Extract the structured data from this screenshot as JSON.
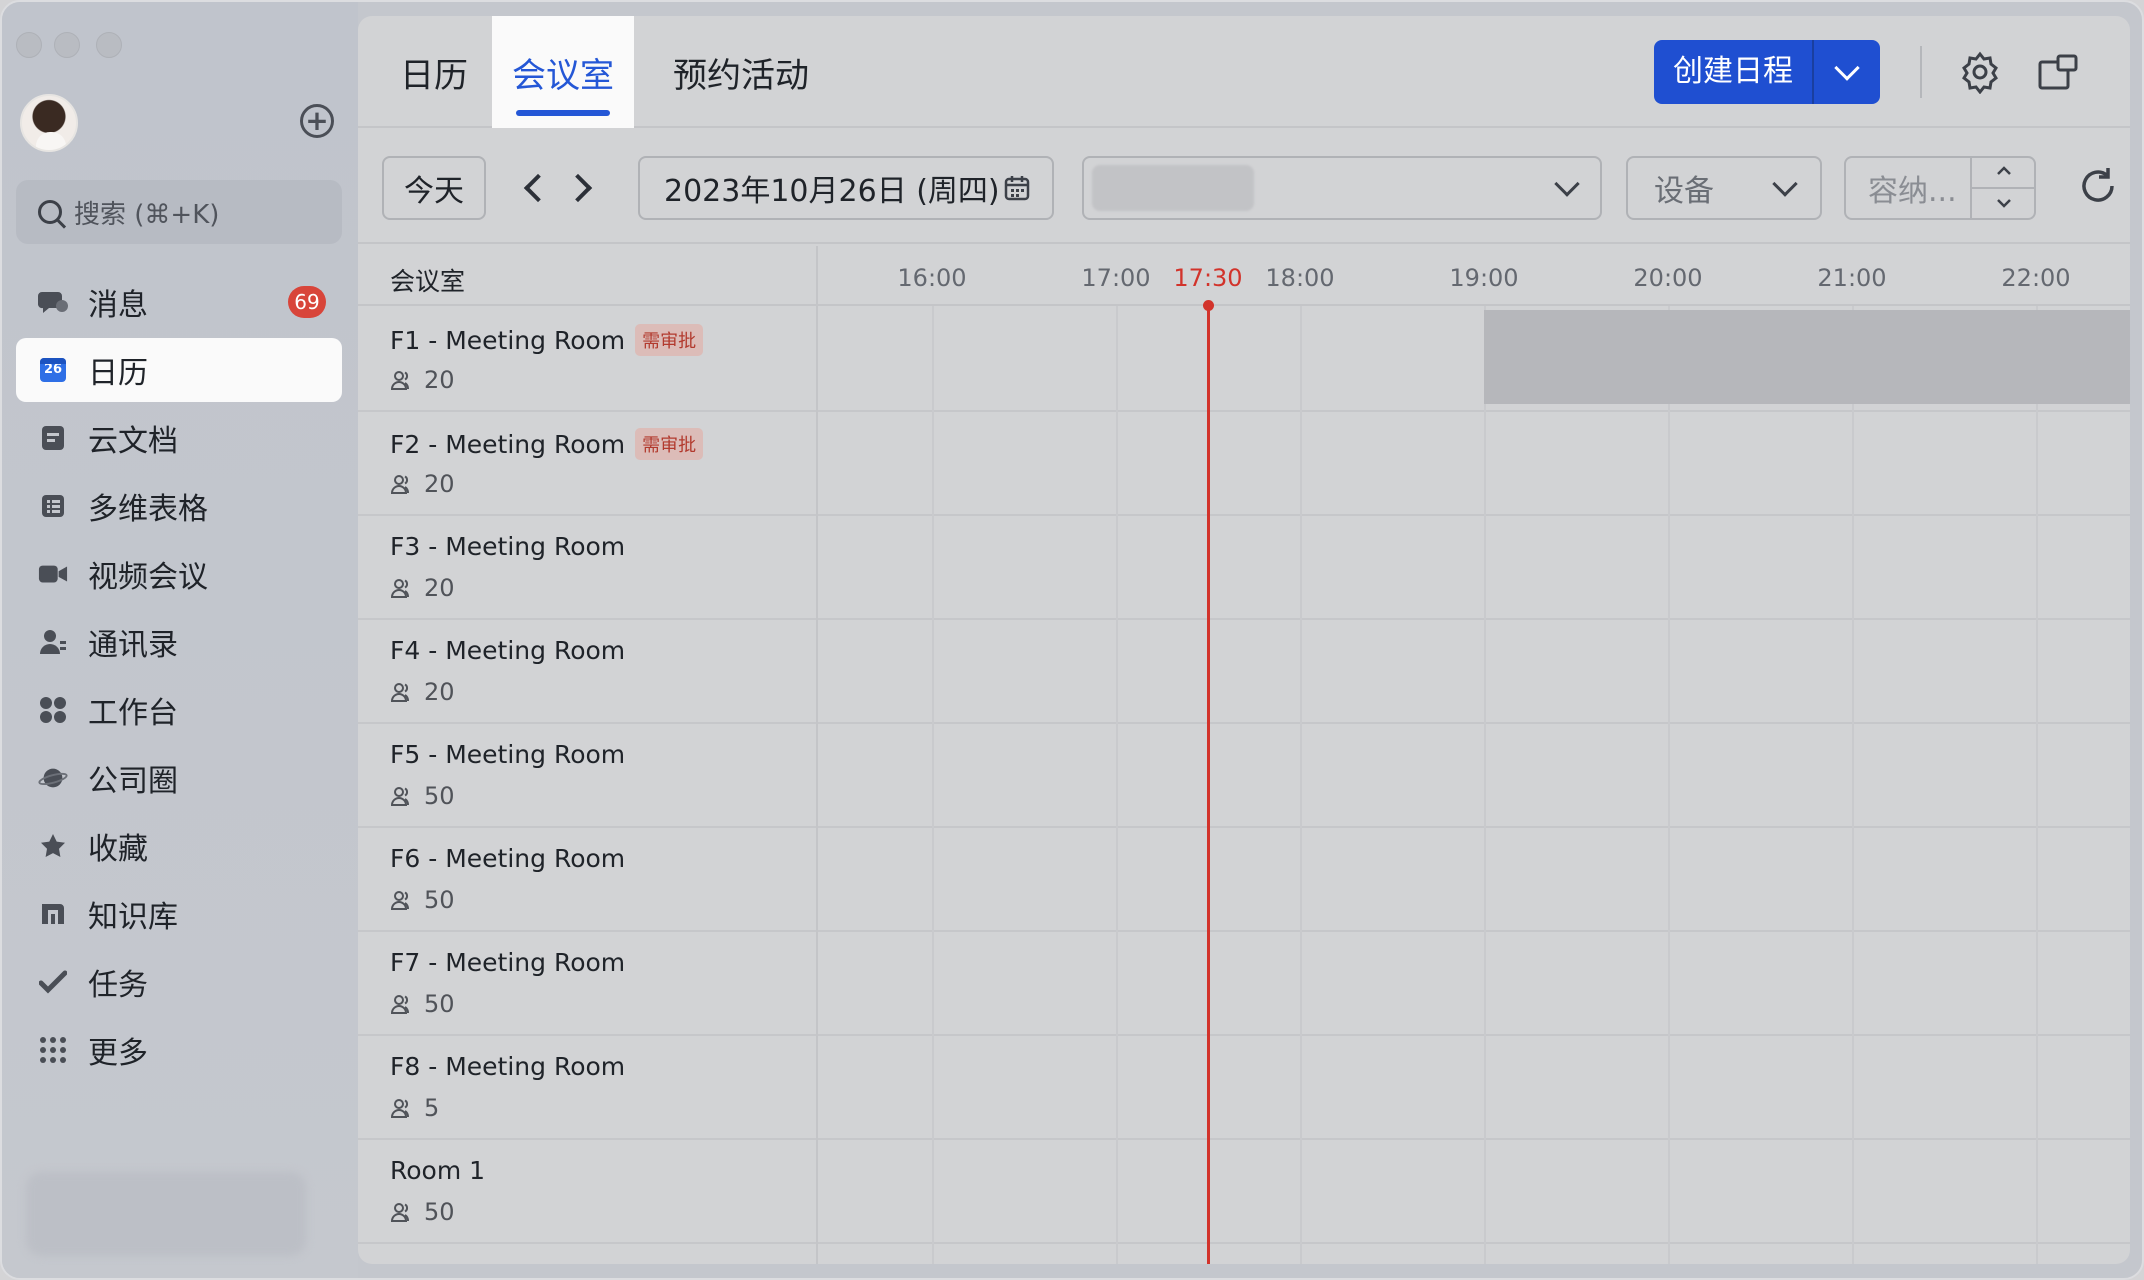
{
  "sidebar": {
    "search_placeholder": "搜索 (⌘+K)",
    "items": [
      {
        "label": "消息",
        "icon": "chat-bubbles-icon",
        "badge": "69"
      },
      {
        "label": "日历",
        "icon": "calendar-icon",
        "icon_text": "26",
        "active": true
      },
      {
        "label": "云文档",
        "icon": "document-icon"
      },
      {
        "label": "多维表格",
        "icon": "table-icon"
      },
      {
        "label": "视频会议",
        "icon": "video-camera-icon"
      },
      {
        "label": "通讯录",
        "icon": "contacts-icon"
      },
      {
        "label": "工作台",
        "icon": "workplace-grid-icon"
      },
      {
        "label": "公司圈",
        "icon": "planet-icon"
      },
      {
        "label": "收藏",
        "icon": "star-icon"
      },
      {
        "label": "知识库",
        "icon": "wiki-icon"
      },
      {
        "label": "任务",
        "icon": "task-check-icon"
      },
      {
        "label": "更多",
        "icon": "more-dots-icon"
      }
    ]
  },
  "header": {
    "tabs": [
      {
        "label": "日历",
        "active": false
      },
      {
        "label": "会议室",
        "active": true
      },
      {
        "label": "预约活动",
        "active": false
      }
    ],
    "create_label": "创建日程"
  },
  "toolbar": {
    "today_label": "今天",
    "date_value": "2023年10月26日 (周四)",
    "equipment_placeholder": "设备",
    "capacity_placeholder": "容纳..."
  },
  "grid": {
    "room_header": "会议室",
    "times": [
      "16:00",
      "17:00",
      "17:30",
      "18:00",
      "19:00",
      "20:00",
      "21:00",
      "22:00"
    ],
    "current_time": "17:30",
    "rooms": [
      {
        "name": "F1 - Meeting Room",
        "tag": "需审批",
        "capacity": "20"
      },
      {
        "name": "F2 - Meeting Room",
        "tag": "需审批",
        "capacity": "20"
      },
      {
        "name": "F3 - Meeting Room",
        "tag": "",
        "capacity": "20"
      },
      {
        "name": "F4 - Meeting Room",
        "tag": "",
        "capacity": "20"
      },
      {
        "name": "F5 - Meeting Room",
        "tag": "",
        "capacity": "50"
      },
      {
        "name": "F6 - Meeting Room",
        "tag": "",
        "capacity": "50"
      },
      {
        "name": "F7 - Meeting Room",
        "tag": "",
        "capacity": "50"
      },
      {
        "name": "F8 - Meeting Room",
        "tag": "",
        "capacity": "5"
      },
      {
        "name": "Room 1",
        "tag": "",
        "capacity": "50"
      }
    ]
  },
  "colors": {
    "accent": "#1f4fd1",
    "now_line": "#d2332b",
    "badge": "#d8453a"
  }
}
